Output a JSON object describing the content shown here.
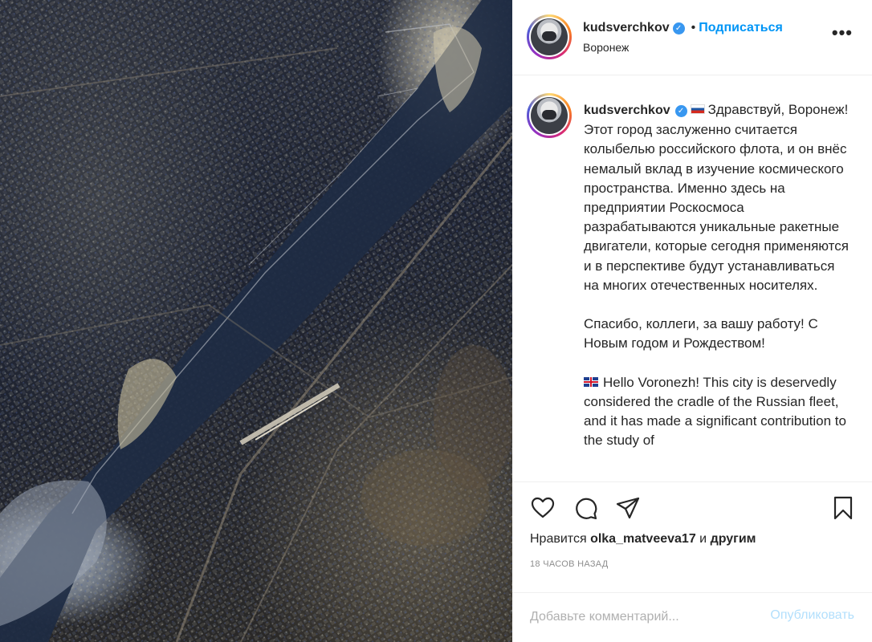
{
  "post": {
    "username": "kudsverchkov",
    "verified_icon": "verified-badge-icon",
    "follow_label": "Подписаться",
    "location": "Воронеж",
    "more_icon": "more-options-icon"
  },
  "caption": {
    "username": "kudsverchkov",
    "flag_ru": "russia-flag-icon",
    "text_ru": "Здравствуй, Воронеж! Этот город заслуженно считается колыбелью российского флота, и он внёс немалый вклад в изучение космического пространства. Именно здесь на предприятии Роскосмоса разрабатываются уникальные ракетные двигатели, которые сегодня применяются и в перспективе будут устанавливаться на многих отечественных носителях.\n\nСпасибо, коллеги, за вашу работу! С Новым годом и Рождеством!\n\n",
    "flag_uk": "uk-flag-icon",
    "text_en": "Hello Voronezh! This city is deservedly considered the cradle of the Russian fleet, and it has made a significant contribution to the study of"
  },
  "actions": {
    "like_icon": "heart-icon",
    "comment_icon": "comment-icon",
    "share_icon": "share-icon",
    "save_icon": "bookmark-icon",
    "likes_prefix": "Нравится",
    "likes_user": "olka_matveeva17",
    "likes_middle": "и",
    "likes_suffix": "другим",
    "timestamp": "18 ЧАСОВ НАЗАД"
  },
  "comment": {
    "placeholder": "Добавьте комментарий...",
    "publish_label": "Опубликовать"
  },
  "colors": {
    "accent": "#0095f6",
    "publish_disabled": "#b2dffc",
    "border": "#efefef",
    "muted": "#8e8e8e"
  }
}
